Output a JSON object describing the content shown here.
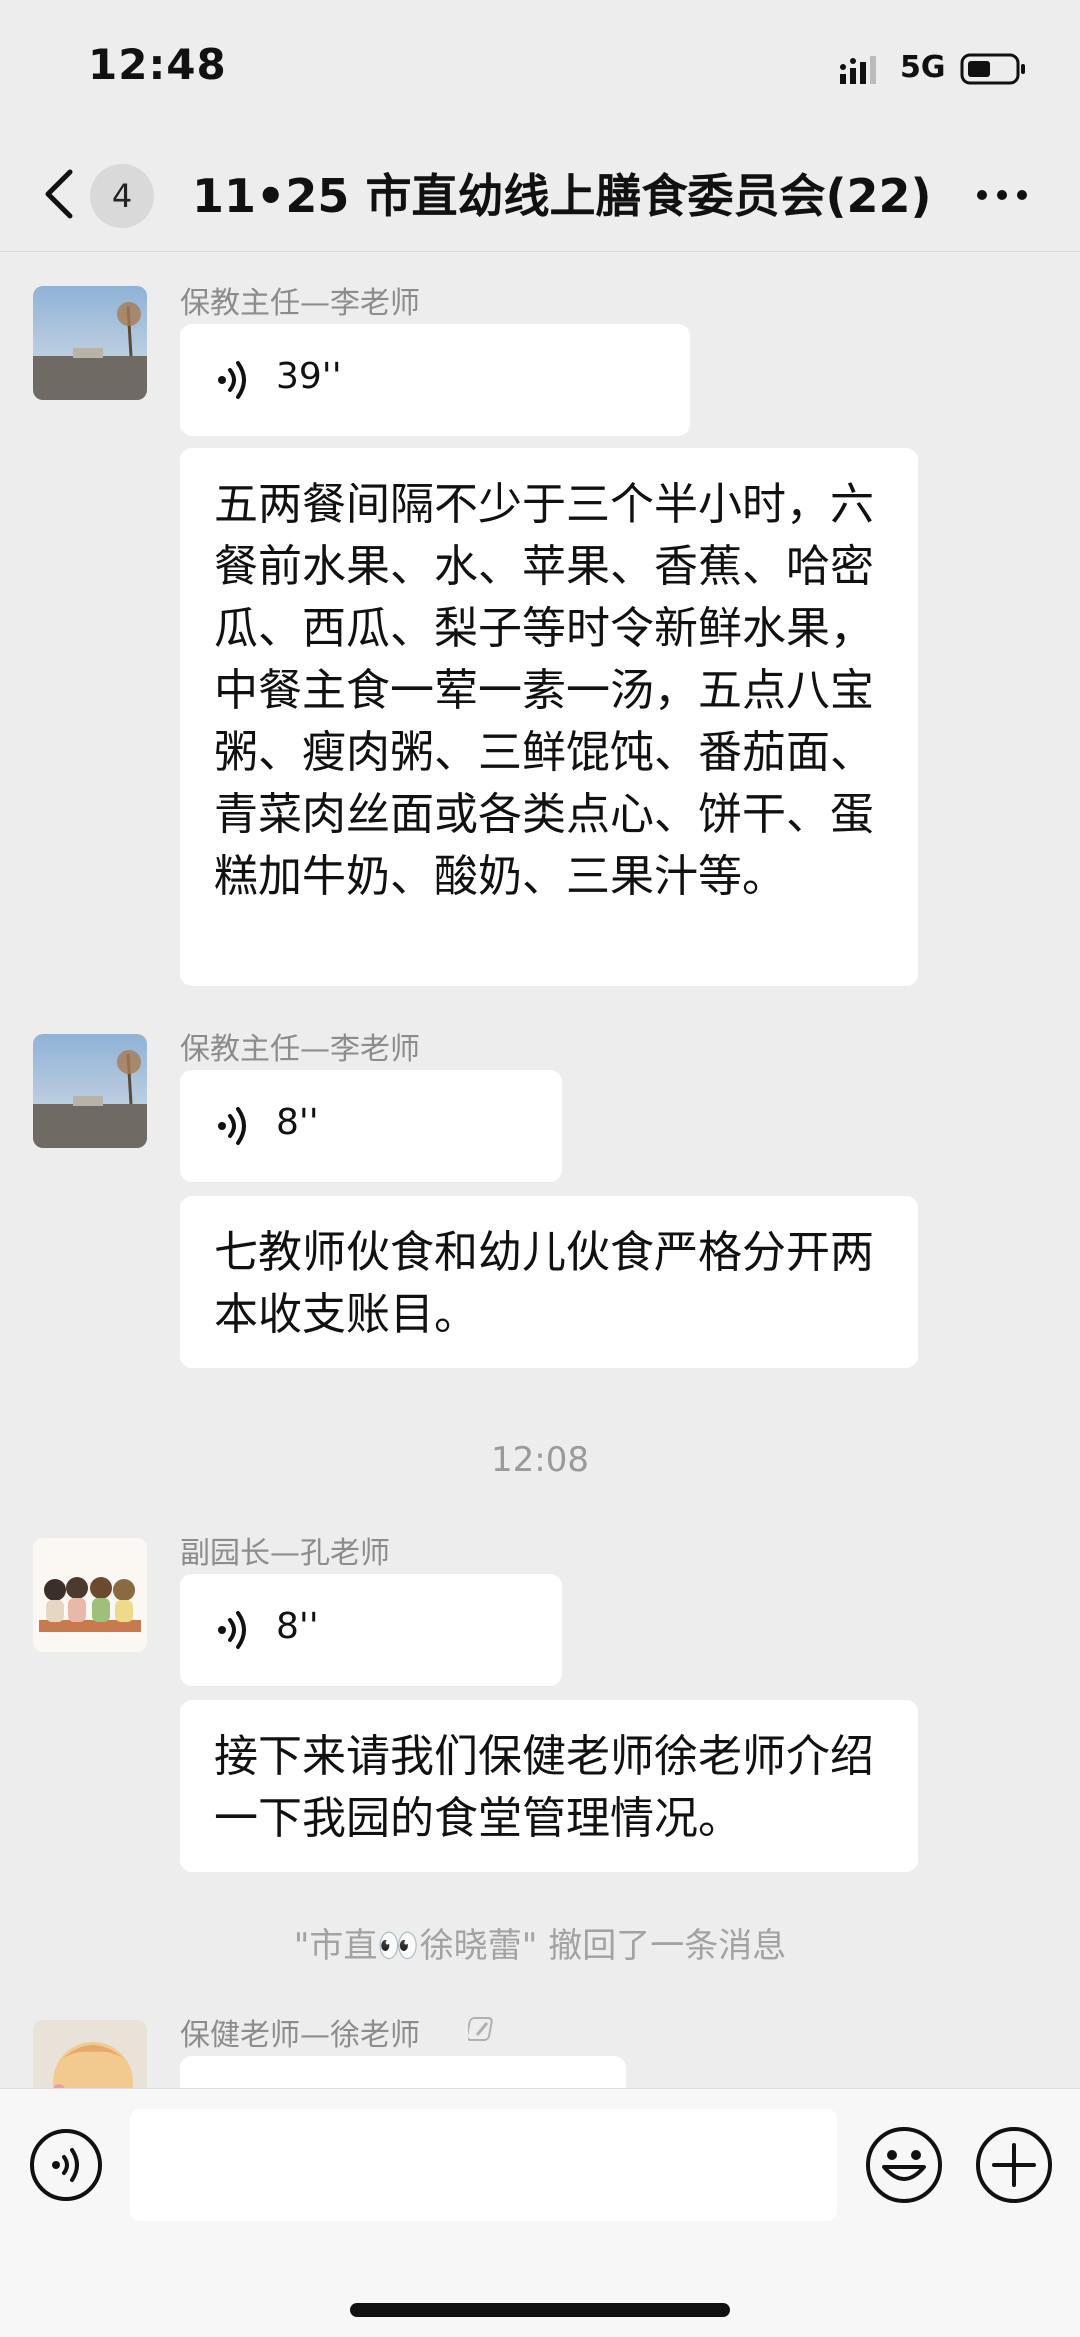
{
  "status_bar": {
    "time": "12:48",
    "network": "5G"
  },
  "header": {
    "unread_count": "4",
    "title": "11•25 市直幼线上膳食委员会(22)"
  },
  "messages": [
    {
      "sender": "保教主任—李老师",
      "voice_duration": "39''",
      "text": "五两餐间隔不少于三个半小时，六餐前水果、水、苹果、香蕉、哈密瓜、西瓜、梨子等时令新鲜水果，中餐主食一荤一素一汤，五点八宝粥、瘦肉粥、三鲜馄饨、番茄面、青菜肉丝面或各类点心、饼干、蛋糕加牛奶、酸奶、三果汁等。"
    },
    {
      "sender": "保教主任—李老师",
      "voice_duration": "8''",
      "text": "七教师伙食和幼儿伙食严格分开两本收支账目。"
    },
    {
      "sender": "副园长—孔老师",
      "voice_duration": "8''",
      "text": "接下来请我们保健老师徐老师介绍一下我园的食堂管理情况。"
    },
    {
      "sender": "保健老师—徐老师"
    }
  ],
  "time_divider": "12:08",
  "recall_notice": "\"市直👀徐晓蕾\" 撤回了一条消息",
  "input_bar": {
    "placeholder": ""
  },
  "colors": {
    "background": "#ededed",
    "bubble": "#ffffff",
    "meta_text": "#8c8c8c"
  }
}
